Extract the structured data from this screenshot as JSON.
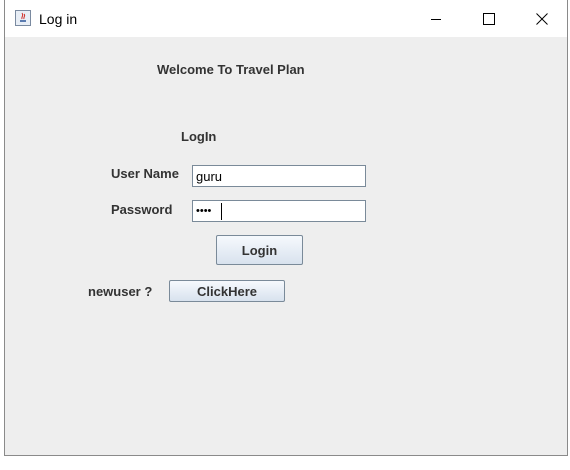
{
  "window": {
    "title": "Log in",
    "icon": "java-app-icon",
    "controls": [
      "minimize-icon",
      "maximize-icon",
      "close-icon"
    ]
  },
  "form": {
    "welcome_text": "Welcome To Travel Plan",
    "heading": "LogIn",
    "username_label": "User Name",
    "username_value": "guru",
    "password_label": "Password",
    "password_value": "••••",
    "login_button": "Login",
    "new_user_label": "newuser ?",
    "click_here_button": "ClickHere"
  }
}
